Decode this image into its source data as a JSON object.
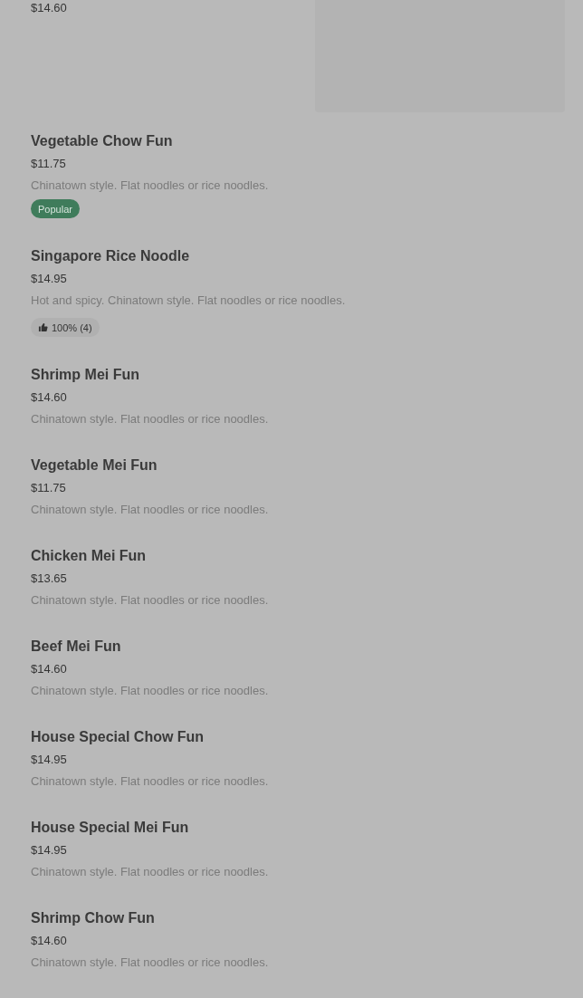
{
  "menu_items": [
    {
      "price": "$14.60",
      "has_image": true
    },
    {
      "name": "Vegetable Chow Fun",
      "price": "$11.75",
      "description": "Chinatown style. Flat noodles or rice noodles.",
      "badge": {
        "kind": "popular",
        "text": "Popular"
      }
    },
    {
      "name": "Singapore Rice Noodle",
      "price": "$14.95",
      "description": "Hot and spicy. Chinatown style. Flat noodles or rice noodles.",
      "badge": {
        "kind": "rating",
        "text": "100% (4)"
      }
    },
    {
      "name": "Shrimp Mei Fun",
      "price": "$14.60",
      "description": "Chinatown style. Flat noodles or rice noodles."
    },
    {
      "name": "Vegetable Mei Fun",
      "price": "$11.75",
      "description": "Chinatown style. Flat noodles or rice noodles."
    },
    {
      "name": "Chicken Mei Fun",
      "price": "$13.65",
      "description": "Chinatown style. Flat noodles or rice noodles."
    },
    {
      "name": "Beef Mei Fun",
      "price": "$14.60",
      "description": "Chinatown style. Flat noodles or rice noodles."
    },
    {
      "name": "House Special Chow Fun",
      "price": "$14.95",
      "description": "Chinatown style. Flat noodles or rice noodles."
    },
    {
      "name": "House Special Mei Fun",
      "price": "$14.95",
      "description": "Chinatown style. Flat noodles or rice noodles."
    },
    {
      "name": "Shrimp Chow Fun",
      "price": "$14.60",
      "description": "Chinatown style. Flat noodles or rice noodles."
    }
  ]
}
